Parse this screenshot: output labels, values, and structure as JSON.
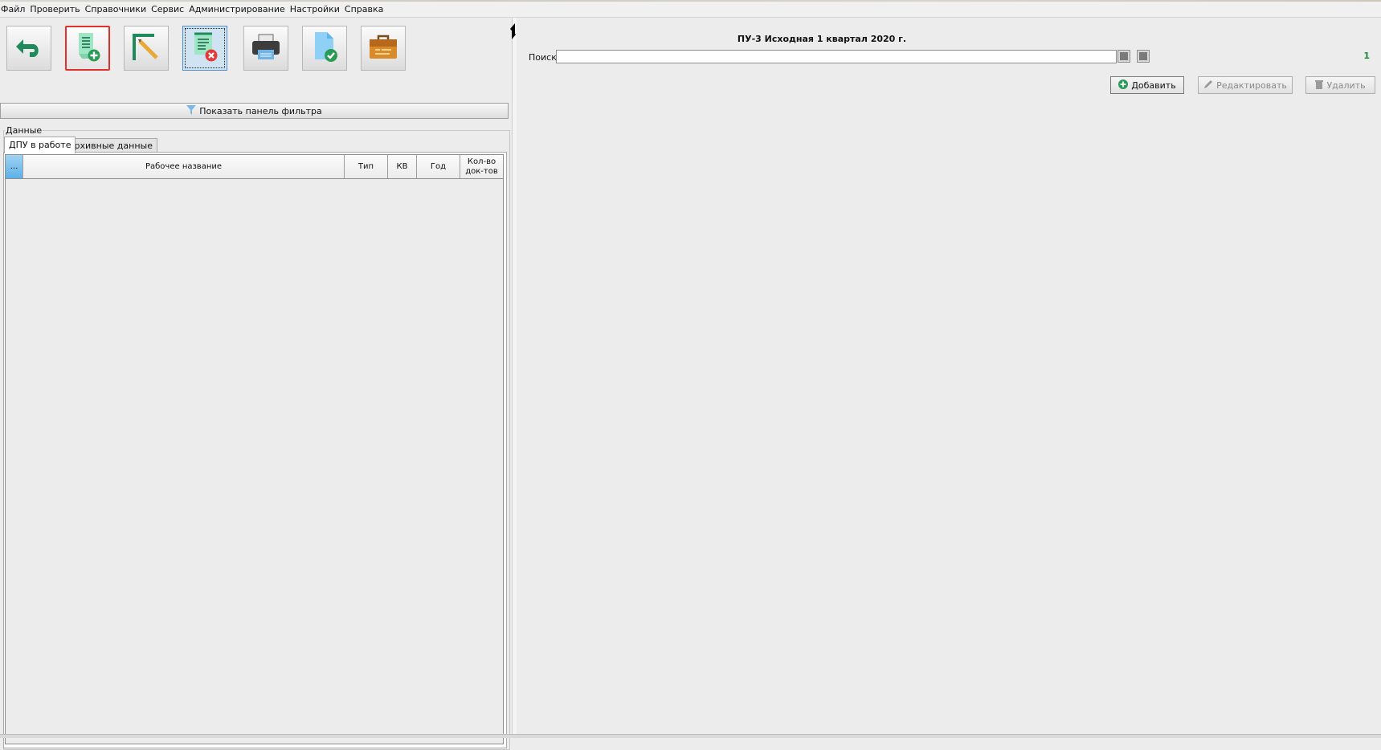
{
  "menu": [
    "Файл",
    "Проверить",
    "Справочники",
    "Сервис",
    "Администрирование",
    "Настройки",
    "Справка"
  ],
  "toolbar": {
    "buttons": [
      {
        "icon": "back-arrow-icon"
      },
      {
        "icon": "add-document-icon"
      },
      {
        "icon": "edit-document-icon"
      },
      {
        "icon": "delete-document-icon"
      },
      {
        "icon": "printer-icon"
      },
      {
        "icon": "check-document-icon"
      },
      {
        "icon": "briefcase-icon"
      }
    ]
  },
  "filter_bar": {
    "label": "Показать панель фильтра"
  },
  "data_group": {
    "title": "Данные",
    "tabs": [
      "ДПУ в работе",
      "Архивные данные"
    ],
    "grid": {
      "columns": [
        "...",
        "Рабочее название",
        "Тип",
        "КВ",
        "Год",
        "Кол-во док-тов"
      ],
      "rows": []
    }
  },
  "right": {
    "title": "ПУ-3 Исходная 1 квартал 2020 г.",
    "search_label": "Поиск:",
    "search_value": "",
    "count": "1",
    "actions": {
      "add": "Добавить",
      "edit": "Редактировать",
      "delete": "Удалить"
    }
  },
  "colors": {
    "accent_green": "#1a8a3a",
    "highlight_red": "#e0322d"
  }
}
